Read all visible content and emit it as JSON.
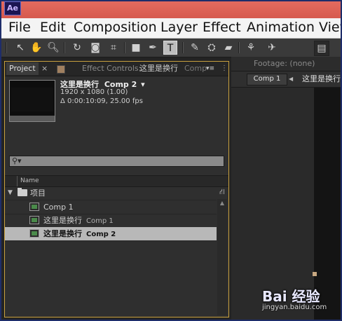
{
  "app": {
    "logo": "Ae"
  },
  "menubar": {
    "items": [
      "File",
      "Edit",
      "Composition",
      "Layer",
      "Effect",
      "Animation",
      "View"
    ]
  },
  "toolbar": {
    "tools": [
      "selection-tool",
      "hand-tool",
      "zoom-tool",
      "rotation-tool",
      "unified-camera-tool",
      "pan-behind-tool",
      "rectangle-tool",
      "pen-tool",
      "type-tool",
      "brush-tool",
      "clone-stamp-tool",
      "eraser-tool",
      "roto-brush-tool",
      "puppet-pin-tool"
    ],
    "active_tool": "type-tool"
  },
  "project_panel": {
    "tab_label": "Project",
    "tab_close": "×",
    "effect_controls_label": "Effect Controls:",
    "effect_controls_target": "这里是换行",
    "effect_controls_comp": "Comp",
    "selected_item": {
      "name": "这里是换行",
      "comp": "Comp 2",
      "resolution": "1920 x 1080 (1.00)",
      "duration": "Δ 0:00:10:09, 25.00 fps"
    },
    "column_name": "Name",
    "tree": [
      {
        "label": "项目",
        "type": "folder"
      },
      {
        "label": "Comp 1",
        "sub": "",
        "type": "comp"
      },
      {
        "label": "这里是换行",
        "sub": "Comp 1",
        "type": "comp"
      },
      {
        "label": "这里是换行",
        "sub": "Comp 2",
        "type": "comp",
        "selected": true
      }
    ]
  },
  "viewer_panel": {
    "footage_tab": "Footage: (none)",
    "comp_button": "Comp 1",
    "comp_name": "这里是换行"
  },
  "watermark": {
    "logo": "Bai 经验",
    "url": "jingyan.baidu.com"
  },
  "colors": {
    "titlebar": "#d65a4e",
    "panel_border": "#c9a13f",
    "selected_row": "#b8b8b8"
  }
}
